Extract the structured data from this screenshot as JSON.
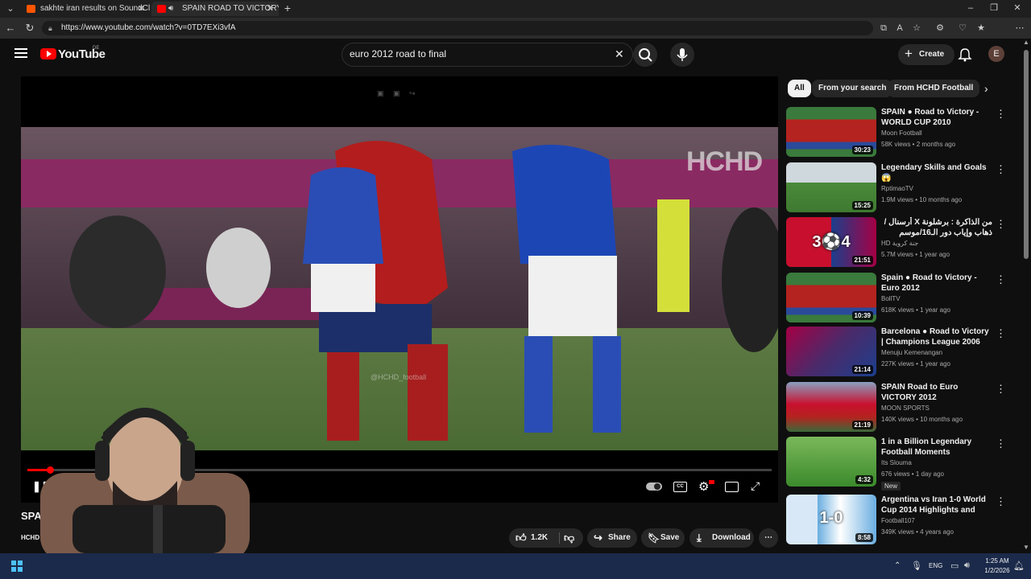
{
  "browser": {
    "tabs": [
      {
        "title": "sakhte iran results on SoundClou",
        "color": "#ff5500"
      },
      {
        "title": "SPAIN ROAD TO VICTORY 20",
        "color": "#ff0000"
      }
    ],
    "url": "https://www.youtube.com/watch?v=0TD7EXi3vfA"
  },
  "youtube": {
    "logo": "YouTube",
    "region": "DE",
    "search_value": "euro 2012 road to final",
    "create_label": "Create",
    "avatar_letter": "E"
  },
  "player": {
    "watermark": "HCHD",
    "handle": "@HCHD_football",
    "progress_fraction": 0.03
  },
  "below": {
    "title_fragment": "SPA",
    "channel_fragment": "HCHD",
    "like_count": "1.2K",
    "share_label": "Share",
    "save_label": "Save",
    "download_label": "Download"
  },
  "chips": [
    "All",
    "From your search",
    "From HCHD Football"
  ],
  "sidebar": [
    {
      "title": "SPAIN ● Road to Victory - WORLD CUP 2010",
      "channel": "Moon Football",
      "meta": "58K views • 2 months ago",
      "duration": "30:23",
      "thumb": "red"
    },
    {
      "title": "Legendary Skills and Goals 😱",
      "channel": "RptimaoTV",
      "meta": "1.9M views • 10 months ago",
      "duration": "15:25",
      "thumb": "field"
    },
    {
      "title": "من الذاكرة : برشلونة X أرسنال /ذهاب وإياب دور الـ16/موسم 2010-2011/ عصام ...",
      "channel": "HD جنة كروية",
      "meta": "5.7M views • 1 year ago",
      "duration": "21:51",
      "thumb": "score",
      "score": "3⚽4"
    },
    {
      "title": "Spain ● Road to Victory - Euro 2012",
      "channel": "BollTV",
      "meta": "618K views • 1 year ago",
      "duration": "10:39",
      "thumb": "red"
    },
    {
      "title": "Barcelona ● Road to Victory | Champions League 2006",
      "channel": "Menuju Kemenangan",
      "meta": "227K views • 1 year ago",
      "duration": "21:14",
      "thumb": "barca"
    },
    {
      "title": "SPAIN Road to Euro VICTORY 2012",
      "channel": "MOON SPORTS",
      "meta": "140K views • 10 months ago",
      "duration": "21:19",
      "thumb": "celebrate"
    },
    {
      "title": "1 in a Billion Legendary Football Moments",
      "channel": "Its Slouma",
      "meta": "676 views • 1 day ago",
      "duration": "4:32",
      "thumb": "green",
      "badge": "New"
    },
    {
      "title": "Argentina vs Iran 1-0 World Cup 2014 Highlights and Goals",
      "channel": "Football107",
      "meta": "349K views • 4 years ago",
      "duration": "8:58",
      "thumb": "argentina",
      "score": "1-0"
    }
  ],
  "taskbar": {
    "lang": "ENG",
    "time": "1:25 AM",
    "date": "1/2/2026"
  },
  "colors": {
    "accent": "#ff0000",
    "bg": "#0f0f0f"
  }
}
